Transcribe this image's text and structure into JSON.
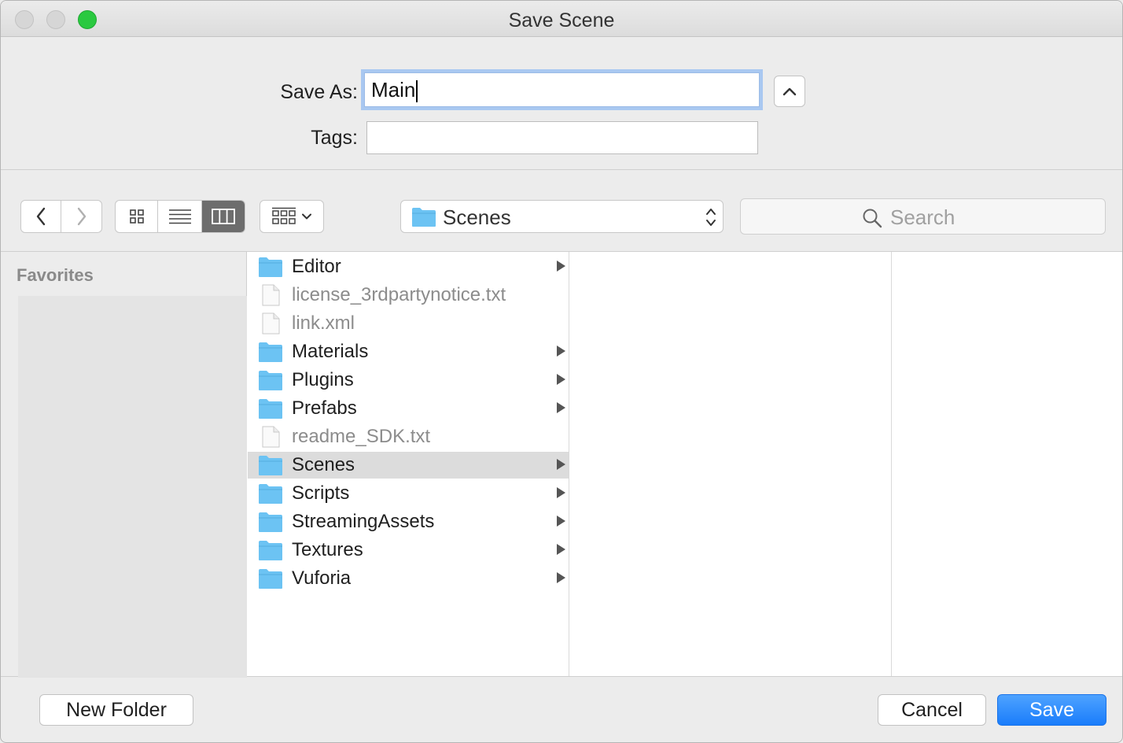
{
  "window": {
    "title": "Save Scene"
  },
  "form": {
    "save_as_label": "Save As:",
    "save_as_value": "Main",
    "tags_label": "Tags:",
    "tags_value": ""
  },
  "toolbar": {
    "location": "Scenes",
    "search_placeholder": "Search",
    "active_view": "columns"
  },
  "sidebar": {
    "heading": "Favorites"
  },
  "files": [
    {
      "name": "Editor",
      "kind": "folder",
      "has_children": true,
      "selected": false
    },
    {
      "name": "license_3rdpartynotice.txt",
      "kind": "file",
      "has_children": false,
      "selected": false
    },
    {
      "name": "link.xml",
      "kind": "file",
      "has_children": false,
      "selected": false
    },
    {
      "name": "Materials",
      "kind": "folder",
      "has_children": true,
      "selected": false
    },
    {
      "name": "Plugins",
      "kind": "folder",
      "has_children": true,
      "selected": false
    },
    {
      "name": "Prefabs",
      "kind": "folder",
      "has_children": true,
      "selected": false
    },
    {
      "name": "readme_SDK.txt",
      "kind": "file",
      "has_children": false,
      "selected": false
    },
    {
      "name": "Scenes",
      "kind": "folder",
      "has_children": true,
      "selected": true
    },
    {
      "name": "Scripts",
      "kind": "folder",
      "has_children": true,
      "selected": false
    },
    {
      "name": "StreamingAssets",
      "kind": "folder",
      "has_children": true,
      "selected": false
    },
    {
      "name": "Textures",
      "kind": "folder",
      "has_children": true,
      "selected": false
    },
    {
      "name": "Vuforia",
      "kind": "folder",
      "has_children": true,
      "selected": false
    }
  ],
  "buttons": {
    "new_folder": "New Folder",
    "cancel": "Cancel",
    "save": "Save"
  },
  "colors": {
    "accent": "#1a7dfb",
    "folder": "#6cc3f3",
    "selection": "#dcdcdc"
  }
}
